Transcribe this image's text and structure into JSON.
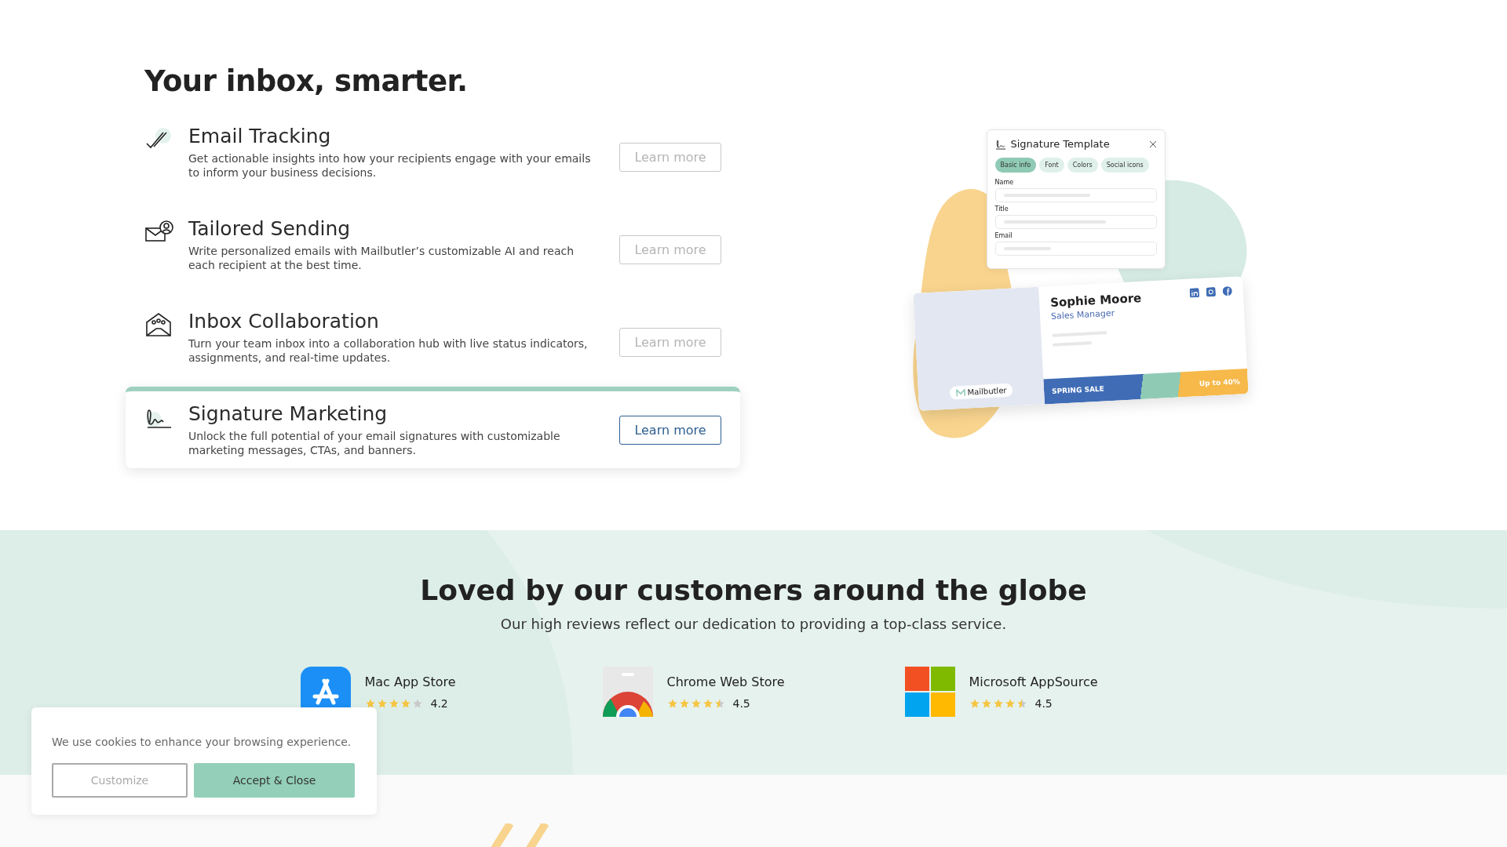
{
  "features": {
    "heading": "Your inbox, smarter.",
    "items": [
      {
        "kind": "tracking",
        "title": "Email Tracking",
        "description": "Get actionable insights into how your recipients engage with your emails to inform your business decisions.",
        "button": "Learn more",
        "selected": false
      },
      {
        "kind": "sending",
        "title": "Tailored Sending",
        "description": "Write personalized emails with Mailbutler’s customizable AI and reach each recipient at the best time.",
        "button": "Learn more",
        "selected": false
      },
      {
        "kind": "collaboration",
        "title": "Inbox Collaboration",
        "description": "Turn your team inbox into a collaboration hub with live status indicators, assignments, and real-time updates.",
        "button": "Learn more",
        "selected": false
      },
      {
        "kind": "signature",
        "title": "Signature Marketing",
        "description": "Unlock the full potential of your email signatures with customizable marketing messages, CTAs, and banners.",
        "button": "Learn more",
        "selected": true
      }
    ]
  },
  "illustration": {
    "panel_title": "Signature Template",
    "tabs": [
      {
        "label": "Basic info",
        "selected": true
      },
      {
        "label": "Font",
        "selected": false
      },
      {
        "label": "Colors",
        "selected": false
      },
      {
        "label": "Social icons",
        "selected": false
      }
    ],
    "fields": [
      "Name",
      "Title",
      "Email"
    ],
    "card": {
      "badge": "Mailbutler",
      "name": "Sophie Moore",
      "role": "Sales Manager",
      "banner_left": "SPRING SALE",
      "banner_right": "Up to 40%"
    }
  },
  "reviews": {
    "heading": "Loved by our customers around the globe",
    "subheading": "Our high reviews reflect our dedication to providing a top-class service.",
    "items": [
      {
        "kind": "apple",
        "store": "Mac App Store",
        "stars": 4,
        "rating": "4.2"
      },
      {
        "kind": "chrome",
        "store": "Chrome Web Store",
        "stars": 4.5,
        "rating": "4.5"
      },
      {
        "kind": "microsoft",
        "store": "Microsoft AppSource",
        "stars": 4.5,
        "rating": "4.5"
      }
    ]
  },
  "cookie_banner": {
    "message": "We use cookies to enhance your browsing experience.",
    "buttons": [
      "Customize",
      "Accept & Close"
    ]
  }
}
